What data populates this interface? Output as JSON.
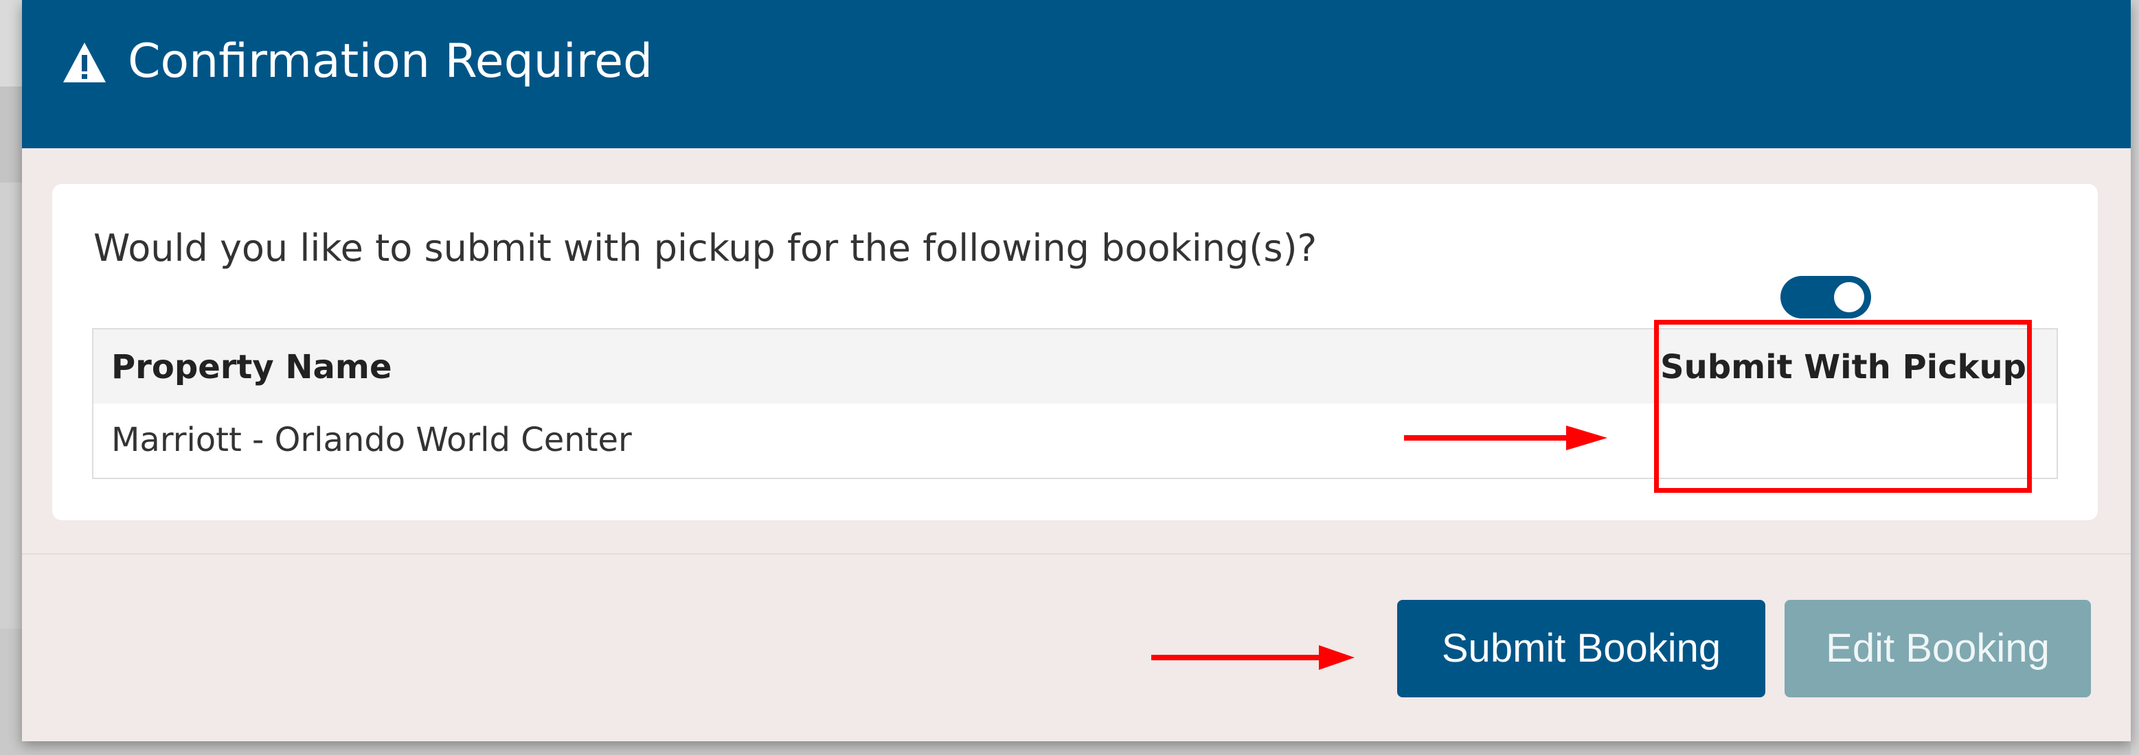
{
  "modal": {
    "title": "Confirmation Required",
    "icon": "warning-icon",
    "question": "Would you like to submit with pickup for the following booking(s)?",
    "table": {
      "headers": [
        "Property Name",
        "Submit With Pickup"
      ],
      "rows": [
        {
          "property_name": "Marriott - Orlando World Center",
          "submit_with_pickup": true
        }
      ]
    },
    "buttons": {
      "submit_label": "Submit Booking",
      "edit_label": "Edit Booking"
    }
  },
  "colors": {
    "header": "#005587",
    "primary_button": "#005587",
    "secondary_button": "#7fa8b0",
    "annotation": "#ff0000",
    "modal_background": "#f2e9e9"
  }
}
